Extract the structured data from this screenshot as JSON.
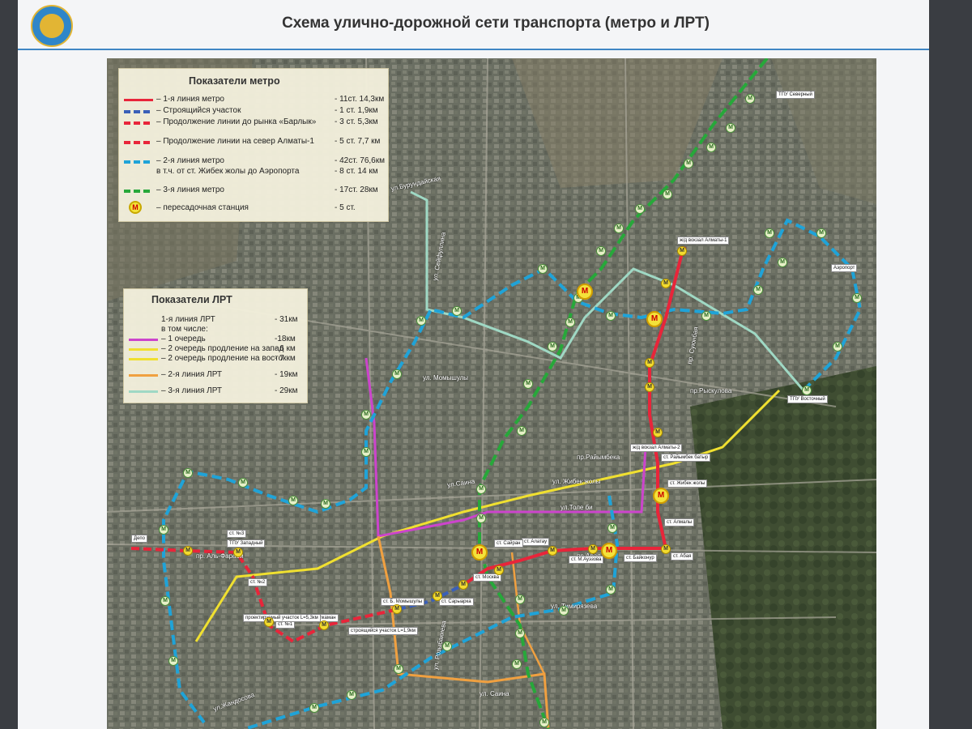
{
  "header": {
    "title": "Схема улично-дорожной сети транспорта (метро и ЛРТ)"
  },
  "metro_legend": {
    "title": "Показатели метро",
    "rows": [
      {
        "label": "– 1-я линия метро",
        "value": "- 11ст. 14,3км",
        "color": "#e8253a",
        "style": "solid"
      },
      {
        "label": "– Строящийся участок",
        "value": "- 1 ст. 1,9км",
        "color": "#3a5fb8",
        "style": "dash"
      },
      {
        "label": "– Продолжение линии до рынка «Барлык»",
        "value": "- 3 ст. 5,3км",
        "color": "#e8253a",
        "style": "dash"
      },
      {
        "label": "– Продолжение линии на север Алматы-1",
        "value": "- 5 ст. 7,7 км",
        "color": "#e8253a",
        "style": "dash"
      },
      {
        "label": "– 2-я линия метро",
        "value": "- 42ст. 76,6км",
        "color": "#1fa3d8",
        "style": "dash"
      },
      {
        "label": "в т.ч. от ст. Жибек жолы до Аэропорта",
        "value": "- 8 ст. 14 км",
        "color": "",
        "style": "none"
      },
      {
        "label": "– 3-я линия метро",
        "value": "- 17ст. 28км",
        "color": "#27a83a",
        "style": "dash"
      },
      {
        "label": "– пересадочная станция",
        "value": "- 5 ст.",
        "color": "",
        "style": "symbol"
      }
    ]
  },
  "lrt_legend": {
    "title": "Показатели ЛРТ",
    "rows": [
      {
        "label": "1-я линия ЛРТ",
        "value": "- 31км",
        "color": "",
        "style": "none"
      },
      {
        "label": "в том числе:",
        "value": "",
        "color": "",
        "style": "none"
      },
      {
        "label": "– 1 очередь",
        "value": "-18км",
        "color": "#cc44cc",
        "style": "solid"
      },
      {
        "label": "– 2 очередь продление на запад",
        "value": "- 6 км",
        "color": "#f0e030",
        "style": "solid"
      },
      {
        "label": "– 2 очередь продление на восток",
        "value": "- 7 км",
        "color": "#f0e030",
        "style": "solid"
      },
      {
        "label": "– 2-я линия ЛРТ",
        "value": "- 19км",
        "color": "#f0a040",
        "style": "solid"
      },
      {
        "label": "– 3-я линия ЛРТ",
        "value": "- 29км",
        "color": "#9fd8c4",
        "style": "solid"
      }
    ]
  },
  "station_symbol": "М",
  "streets": [
    "ул.Бурундайская",
    "ул. Сейфуллина",
    "пр.Райымбека",
    "ул.Толе би",
    "ул. Жибек жолы",
    "пр.Рыскулова",
    "ул. Момышулы",
    "ул.Саина",
    "ул. Тимирязева",
    "пр. Суюнбая",
    "пр.Абая",
    "ул.Жандосова",
    "пр. Аль-Фараби",
    "ул. Розыбакиева",
    "ул. Саина"
  ],
  "station_labels": [
    "ТПУ Северный",
    "ТПУ Восточный",
    "ТПУ Западный",
    "ст. №3",
    "ст. №2",
    "ст. №1",
    "ж/д вокзал Алматы-1",
    "ж/д вокзал Алматы-2",
    "ст. Жибек жолы",
    "ст. Райымбек батыр",
    "ст. Алмалы",
    "ст. Абая",
    "ст. Байконур",
    "ст. М.Ауэзова",
    "ст. Алатау",
    "ст. Сайран",
    "ст. Москва",
    "ст. Сарыарка",
    "ст. Б. Момышулы",
    "ст. Калкаман",
    "строящийся участок L=1,9км",
    "проектируемый участок L=5,3км",
    "Аэропорт",
    "Депо"
  ],
  "colors": {
    "metro1": "#e8253a",
    "metro2": "#1fa3d8",
    "metro3": "#27a83a",
    "lrt1": "#cc44cc",
    "lrt1_ext": "#f0e030",
    "lrt2": "#f0a040",
    "lrt3": "#9fd8c4",
    "construction": "#3a5fb8"
  }
}
